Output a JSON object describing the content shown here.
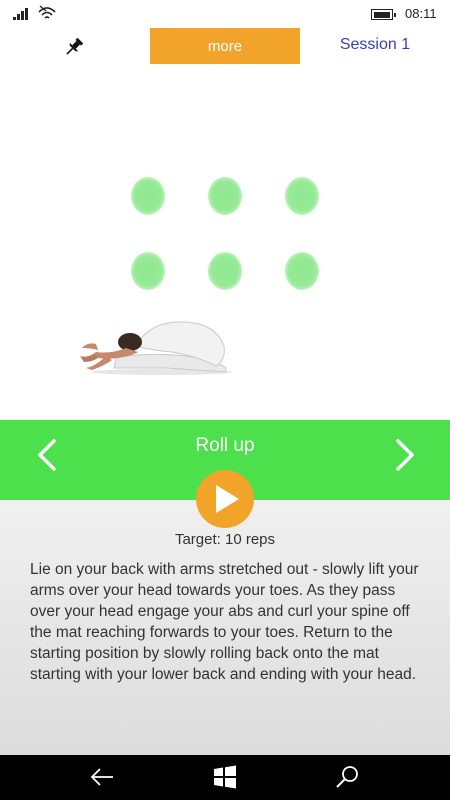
{
  "status_bar": {
    "time": "08:11",
    "signal_icon": "signal-icon",
    "wifi_icon": "wifi-icon",
    "battery_icon": "battery-icon",
    "battery_level": 0.9
  },
  "top_bar": {
    "pin_icon": "pin-icon",
    "more_label": "more",
    "session_label": "Session 1"
  },
  "exercise": {
    "title": "Roll up",
    "prev_icon": "chevron-left-icon",
    "next_icon": "chevron-right-icon",
    "play_icon": "play-icon",
    "target": "Target: 10 reps",
    "description": "Lie on your back with arms stretched out - slowly lift your arms over your head towards your toes. As they pass over your head engage your abs and curl your spine off the mat reaching forwards to your toes. Return to the starting position by slowly rolling back onto the mat starting with your lower back and ending with your head.",
    "rep_dots": 6
  },
  "colors": {
    "accent_orange": "#f2a42a",
    "green_bar": "#4de04d",
    "dot_green": "#96ea96",
    "session_blue": "#3a3fbd"
  },
  "nav_bar": {
    "back_icon": "back-arrow-icon",
    "windows_icon": "windows-logo-icon",
    "search_icon": "search-icon"
  }
}
